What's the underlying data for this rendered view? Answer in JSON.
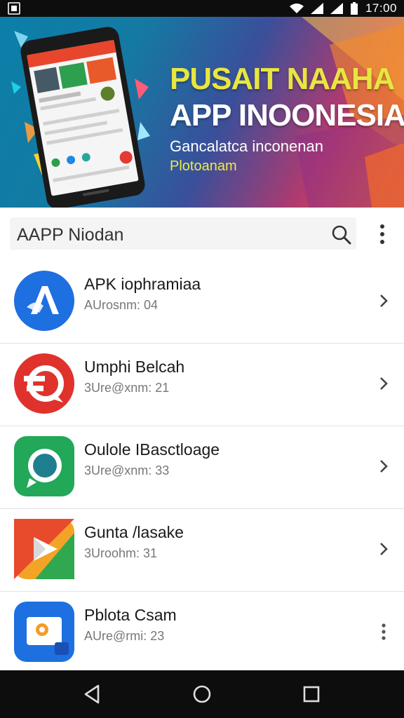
{
  "status_bar": {
    "time": "17:00",
    "icons": [
      "screenshot-icon",
      "wifi-icon",
      "signal-icon",
      "signal-icon",
      "battery-icon"
    ]
  },
  "banner": {
    "title_line1": "PUSAIT NAAHA",
    "title_line2": "APP INOONESIA",
    "subtitle_line1": "Gancalatca inconenan",
    "subtitle_line2": "Plotoanam",
    "colors": {
      "title_yellow": "#e8e640",
      "gradient_start": "#0b7fa8",
      "gradient_end": "#f36b2a"
    }
  },
  "app_bar": {
    "title": "AAPP  Niodan",
    "icons": [
      "search-icon",
      "more-vert-icon"
    ]
  },
  "apps": [
    {
      "name": "APK iophramiaa",
      "meta": "AUrosnm: 04",
      "icon": "blue-a-icon",
      "action": "chevron-right-icon",
      "color": "#1e6fe0"
    },
    {
      "name": "Umphi Belcah",
      "meta": "3Ure@xnm: 21",
      "icon": "red-chat-icon",
      "action": "chevron-right-icon",
      "color": "#e0322c"
    },
    {
      "name": "Oulole IBasctloage",
      "meta": "3Ure@xnm: 33",
      "icon": "green-camera-icon",
      "action": "chevron-right-icon",
      "color": "#22a858"
    },
    {
      "name": "Gunta /lasake",
      "meta": "3Uroohm: 31",
      "icon": "multicolor-play-icon",
      "action": "chevron-right-icon",
      "color": "#f3a326"
    },
    {
      "name": "Pblota Csam",
      "meta": "AUre@rmi: 23",
      "icon": "blue-photo-icon",
      "action": "more-vert-icon",
      "color": "#1e6fe0"
    }
  ],
  "nav_bar": {
    "buttons": [
      "back-icon",
      "home-icon",
      "recents-icon"
    ]
  }
}
